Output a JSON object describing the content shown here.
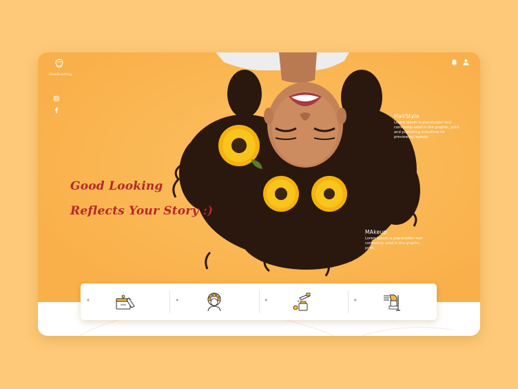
{
  "brand": {
    "name": "GoodLooking"
  },
  "hero": {
    "tagline_line1": "Good Looking",
    "tagline_line2": "Reflects Your Story :)"
  },
  "sections": [
    {
      "title": "HairStyle",
      "text": "Lorem ipsum is placeholder text commonly used in the graphic, print, and publishing industries for previewing layouts."
    },
    {
      "title": "MAkeup",
      "text": "Lorem ipsum is placeholder text commonly used in the graphic, print."
    }
  ],
  "top_icons": [
    "bell-icon",
    "user-icon"
  ],
  "social_icons": [
    "instagram-icon",
    "facebook-icon"
  ],
  "services": [
    {
      "name": "skincare-cream-icon"
    },
    {
      "name": "hair-curlers-icon"
    },
    {
      "name": "cosmetics-dropper-icon"
    },
    {
      "name": "hairdryer-salon-icon"
    }
  ],
  "colors": {
    "background": "#fec978",
    "hero": "#fbb752",
    "tagline": "#b8262a",
    "white": "#ffffff"
  }
}
